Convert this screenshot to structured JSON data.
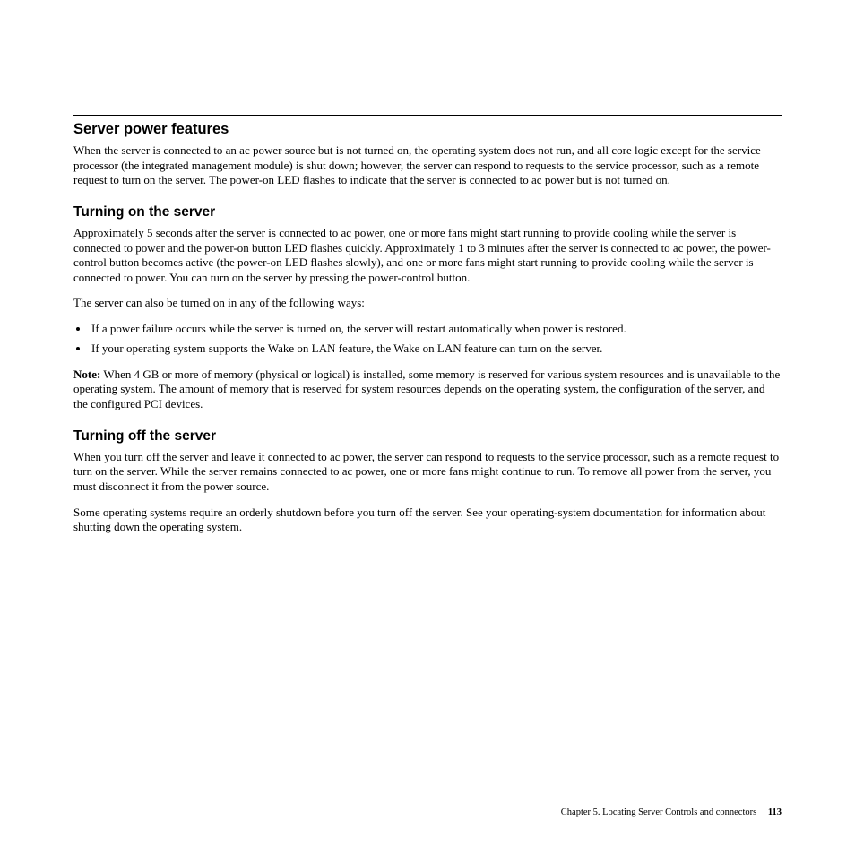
{
  "section1": {
    "title": "Server power features",
    "p1": "When the server is connected to an ac power source but is not turned on, the operating system does not run, and all core logic except for the service processor (the integrated management module) is shut down; however, the server can respond to requests to the service processor, such as a remote request to turn on the server. The power-on LED flashes to indicate that the server is connected to ac power but is not turned on."
  },
  "section2": {
    "title": "Turning on the server",
    "p1": "Approximately 5 seconds after the server is connected to ac power, one or more fans might start running to provide cooling while the server is connected to power and the power-on button LED flashes quickly. Approximately 1 to 3 minutes after the server is connected to ac power, the power-control button becomes active (the power-on LED flashes slowly), and one or more fans might start running to provide cooling while the server is connected to power. You can turn on the server by pressing the power-control button.",
    "p2": "The server can also be turned on in any of the following ways:",
    "li1": "If a power failure occurs while the server is turned on, the server will restart automatically when power is restored.",
    "li2": "If your operating system supports the Wake on LAN feature, the Wake on LAN feature can turn on the server.",
    "noteLabel": "Note:",
    "noteText": "  When 4 GB or more of memory (physical or logical) is installed, some memory is reserved for various system resources and is unavailable to the operating system. The amount of memory that is reserved for system resources depends on the operating system, the configuration of the server, and the configured PCI devices."
  },
  "section3": {
    "title": "Turning off the server",
    "p1": "When you turn off the server and leave it connected to ac power, the server can respond to requests to the service processor, such as a remote request to turn on the server. While the server remains connected to ac power, one or more fans might continue to run. To remove all power from the server, you must disconnect it from the power source.",
    "p2": "Some operating systems require an orderly shutdown before you turn off the server. See your operating-system documentation for information about shutting down the operating system."
  },
  "footer": {
    "chapter": "Chapter 5. Locating Server Controls and connectors",
    "page": "113"
  }
}
